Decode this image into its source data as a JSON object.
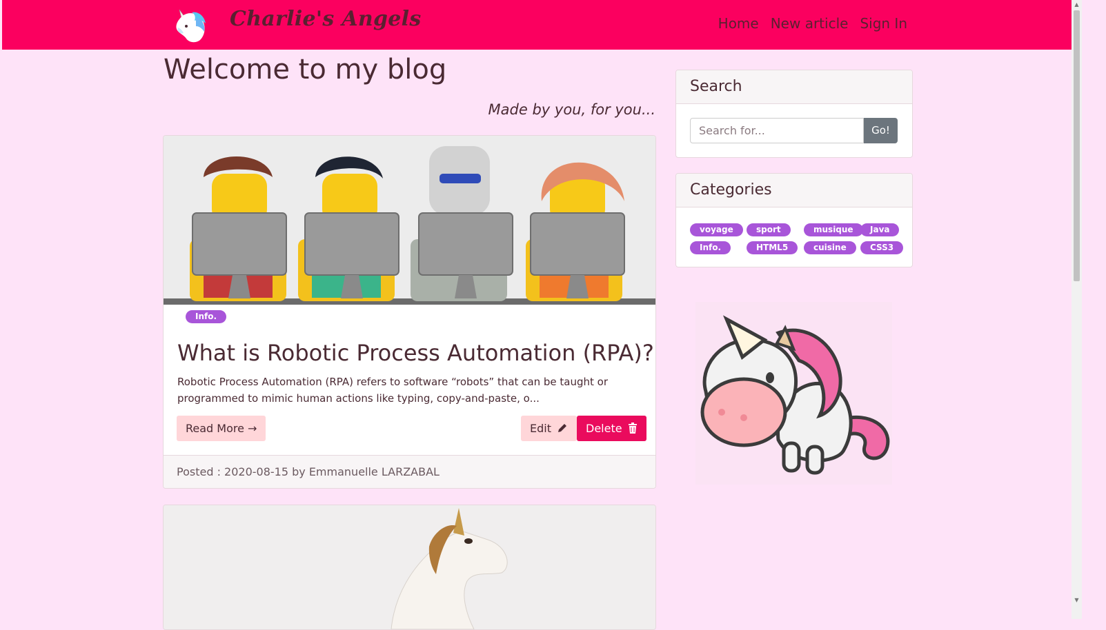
{
  "navbar": {
    "brand": "Charlie's Angels",
    "links": [
      {
        "label": "Home"
      },
      {
        "label": "New article"
      },
      {
        "label": "Sign In"
      }
    ]
  },
  "main": {
    "title": "Welcome to my blog",
    "tagline": "Made by you, for you...",
    "post": {
      "badge": "Info.",
      "title": "What is Robotic Process Automation (RPA)?",
      "excerpt": "Robotic Process Automation (RPA) refers to software “robots” that can be taught or programmed to mimic human actions like typing, copy-and-paste, o...",
      "read_more": "Read More →",
      "edit": "Edit",
      "delete": "Delete",
      "footer": "Posted : 2020-08-15 by Emmanuelle LARZABAL"
    }
  },
  "sidebar": {
    "search": {
      "title": "Search",
      "placeholder": "Search for...",
      "button": "Go!"
    },
    "categories": {
      "title": "Categories",
      "items": [
        "voyage",
        "sport",
        "musique",
        "Java",
        "Info.",
        "HTML5",
        "cuisine",
        "CSS3"
      ]
    }
  },
  "colors": {
    "navbar": "#fb005f",
    "page_bg": "#fee3f8",
    "badge": "#a855d9",
    "delete": "#ea0b5d",
    "soft_button": "#ffd6d9"
  }
}
